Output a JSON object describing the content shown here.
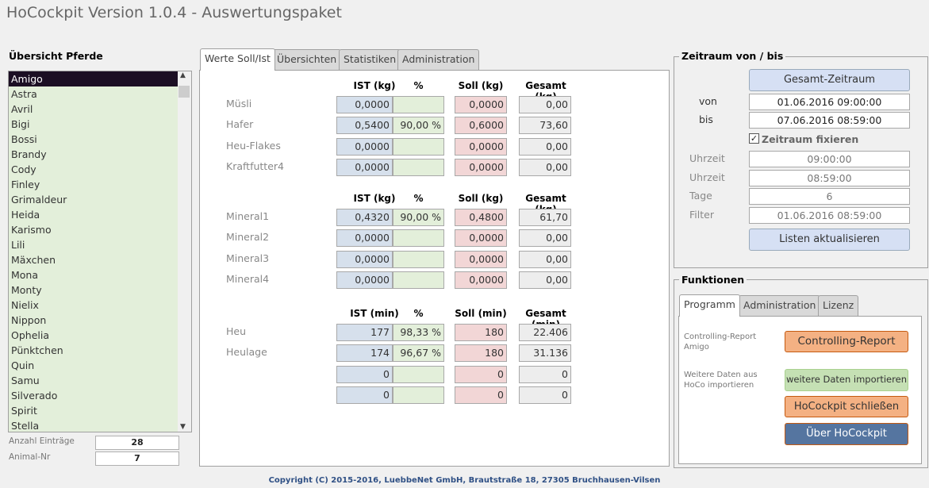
{
  "app": {
    "title": "HoCockpit Version 1.0.4 - Auswertungspaket"
  },
  "horses": {
    "heading": "Übersicht Pferde",
    "selected": "Amigo",
    "items": [
      "Amigo",
      "Astra",
      "Avril",
      "Bigi",
      "Bossi",
      "Brandy",
      "Cody",
      "Finley",
      "Grimaldeur",
      "Heida",
      "Karismo",
      "Lili",
      "Mäxchen",
      "Mona",
      "Monty",
      "Nielix",
      "Nippon",
      "Ophelia",
      "Pünktchen",
      "Quin",
      "Samu",
      "Silverado",
      "Spirit",
      "Stella"
    ],
    "count_label": "Anzahl Einträge",
    "count_value": "28",
    "animal_label": "Animal-Nr",
    "animal_value": "7"
  },
  "main": {
    "tabs": [
      "Werte Soll/Ist",
      "Übersichten",
      "Statistiken",
      "Administration"
    ],
    "active_tab": "Werte Soll/Ist",
    "sections": [
      {
        "headers": [
          "IST (kg)",
          "%",
          "Soll (kg)",
          "Gesamt (kg)"
        ],
        "rows": [
          {
            "label": "Müsli",
            "ist": "0,0000",
            "pct": "",
            "soll": "0,0000",
            "ges": "0,00"
          },
          {
            "label": "Hafer",
            "ist": "0,5400",
            "pct": "90,00 %",
            "soll": "0,6000",
            "ges": "73,60"
          },
          {
            "label": "Heu-Flakes",
            "ist": "0,0000",
            "pct": "",
            "soll": "0,0000",
            "ges": "0,00"
          },
          {
            "label": "Kraftfutter4",
            "ist": "0,0000",
            "pct": "",
            "soll": "0,0000",
            "ges": "0,00"
          }
        ]
      },
      {
        "headers": [
          "IST (kg)",
          "%",
          "Soll (kg)",
          "Gesamt (kg)"
        ],
        "rows": [
          {
            "label": "Mineral1",
            "ist": "0,4320",
            "pct": "90,00 %",
            "soll": "0,4800",
            "ges": "61,70"
          },
          {
            "label": "Mineral2",
            "ist": "0,0000",
            "pct": "",
            "soll": "0,0000",
            "ges": "0,00"
          },
          {
            "label": "Mineral3",
            "ist": "0,0000",
            "pct": "",
            "soll": "0,0000",
            "ges": "0,00"
          },
          {
            "label": "Mineral4",
            "ist": "0,0000",
            "pct": "",
            "soll": "0,0000",
            "ges": "0,00"
          }
        ]
      },
      {
        "headers": [
          "IST (min)",
          "%",
          "Soll (min)",
          "Gesamt (min)"
        ],
        "rows": [
          {
            "label": "Heu",
            "ist": "177",
            "pct": "98,33 %",
            "soll": "180",
            "ges": "22.406"
          },
          {
            "label": "Heulage",
            "ist": "174",
            "pct": "96,67 %",
            "soll": "180",
            "ges": "31.136"
          },
          {
            "label": "",
            "ist": "0",
            "pct": "",
            "soll": "0",
            "ges": "0"
          },
          {
            "label": "",
            "ist": "0",
            "pct": "",
            "soll": "0",
            "ges": "0"
          }
        ]
      }
    ]
  },
  "period": {
    "heading": "Zeitraum von / bis",
    "full_button": "Gesamt-Zeitraum",
    "von_label": "von",
    "von": "01.06.2016 09:00:00",
    "bis_label": "bis",
    "bis": "07.06.2016 08:59:00",
    "fix_label": "Zeitraum fixieren",
    "fix_checked": true,
    "uhrzeit1_label": "Uhrzeit",
    "uhrzeit1": "09:00:00",
    "uhrzeit2_label": "Uhrzeit",
    "uhrzeit2": "08:59:00",
    "tage_label": "Tage",
    "tage": "6",
    "filter_label": "Filter",
    "filter": "01.06.2016 08:59:00",
    "refresh_button": "Listen aktualisieren"
  },
  "functions": {
    "heading": "Funktionen",
    "tabs": [
      "Programm",
      "Administration",
      "Lizenz"
    ],
    "active_tab": "Programm",
    "report_label": "Controlling-Report",
    "report_horse": "Amigo",
    "report_button": "Controlling-Report",
    "import_label": "Weitere Daten aus HoCo importieren",
    "import_button": "weitere Daten importieren",
    "close_button": "HoCockpit schließen",
    "about_button": "Über HoCockpit"
  },
  "colors": {
    "ist": "#d6e0ec",
    "pct": "#e3efda",
    "soll": "#f2d6d6",
    "orange": "#f4b183",
    "green": "#c5e0b4",
    "blue": "#5575a0"
  },
  "footer": {
    "copyright": "Copyright (C) 2015-2016, LuebbeNet GmbH, Brautstraße 18, 27305 Bruchhausen-Vilsen"
  }
}
